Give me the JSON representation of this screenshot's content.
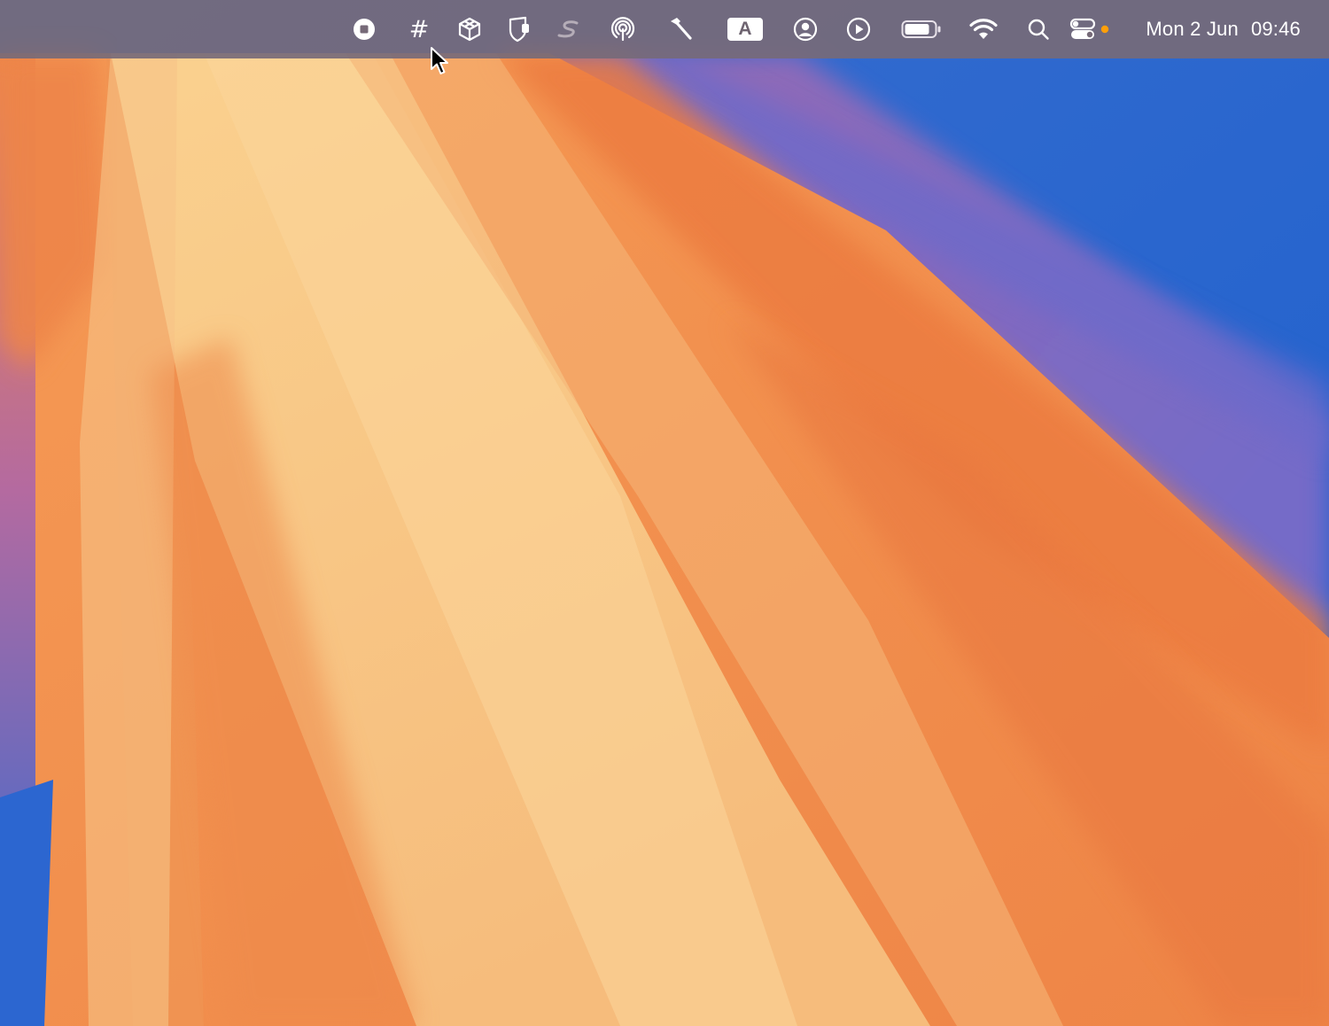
{
  "menubar": {
    "status_items": [
      {
        "name": "screen-recording-stop-icon"
      },
      {
        "name": "hash-icon",
        "glyph": "#"
      },
      {
        "name": "cube-icon"
      },
      {
        "name": "privacy-shield-icon"
      },
      {
        "name": "scribble-s-icon"
      },
      {
        "name": "airdrop-icon"
      },
      {
        "name": "hammer-icon"
      },
      {
        "name": "keyboard-input-icon",
        "glyph": "A"
      },
      {
        "name": "user-account-icon"
      },
      {
        "name": "play-circle-icon"
      },
      {
        "name": "battery-icon"
      },
      {
        "name": "wifi-icon"
      },
      {
        "name": "spotlight-search-icon"
      },
      {
        "name": "control-center-icon"
      }
    ],
    "date": "Mon 2 Jun",
    "time": "09:46"
  },
  "colors": {
    "menubar_bg": "#766a78",
    "accent_dot": "#ff9f0a",
    "wallpaper_orange": "#f08a4b",
    "wallpaper_light": "#f9c98c",
    "wallpaper_blue": "#1f63d0",
    "wallpaper_purple": "#8c6fc0"
  }
}
